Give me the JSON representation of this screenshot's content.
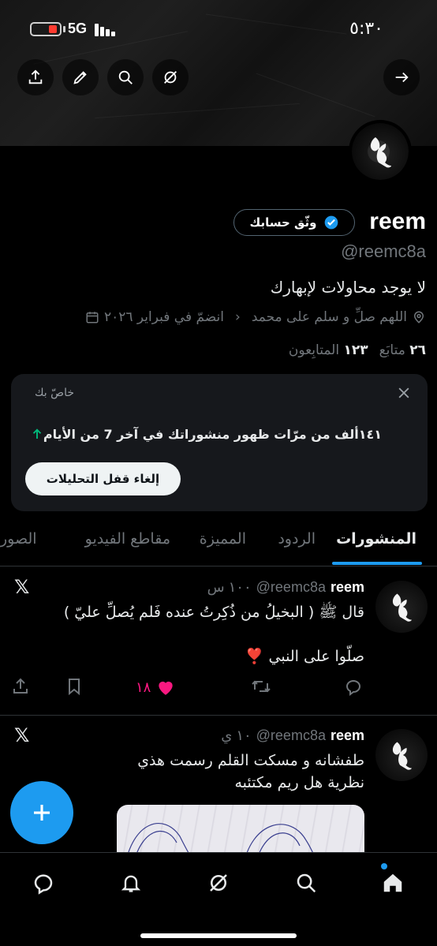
{
  "status_bar": {
    "network": "5G",
    "time": "٥:٣٠"
  },
  "profile": {
    "name": "reem",
    "handle": "@reemc8a",
    "verify_label": "وثّق حسابك",
    "bio": "لا يوجد محاولات لإبهارك",
    "location": "اللهم صلِّ و سلم على محمد",
    "joined": "انضمّ في فبراير ٢٠٢٦",
    "following_count": "٢٦",
    "following_label": "متابَع",
    "followers_count": "١٢٣",
    "followers_label": "المتابِعون"
  },
  "analytics_card": {
    "private_label": "خاصّ بك",
    "stat_text": "١٤١ألف من مرّات ظهور منشوراتك في آخر 7 من الأيام",
    "unlock_button": "إلغاء قفل التحليلات"
  },
  "tabs": [
    {
      "label": "المنشورات",
      "active": true
    },
    {
      "label": "الردود",
      "active": false
    },
    {
      "label": "المميزة",
      "active": false
    },
    {
      "label": "مقاطع الفيديو",
      "active": false
    },
    {
      "label": "الصور",
      "active": false
    }
  ],
  "posts": [
    {
      "name": "reem",
      "handle": "@reemc8a",
      "time": "١٠٠ س",
      "text_line1": "قال ﷺ ( البخيلُ من ذُكِرتُ عنده فَلم يُصلِّ عليّ )",
      "text_line2": "صلّوا على النبي ❣️",
      "likes": "١٨"
    },
    {
      "name": "reem",
      "handle": "@reemc8a",
      "time": "١٠ ي",
      "text_line1": "طفشانه و مسكت القلم رسمت هذي",
      "text_line2": "نظرية هل ريم مكتئبه"
    }
  ],
  "icons": {
    "share": "share-icon",
    "edit": "pencil-icon",
    "search": "search-icon",
    "grok": "grok-icon",
    "back": "arrow-right-icon",
    "verified": "verified-badge-icon",
    "location": "location-pin-icon",
    "calendar": "calendar-icon",
    "close": "close-icon",
    "trend_up": "arrow-up-icon"
  },
  "colors": {
    "accent": "#1d9bf0",
    "like": "#f91880",
    "trend": "#00ba7c"
  }
}
